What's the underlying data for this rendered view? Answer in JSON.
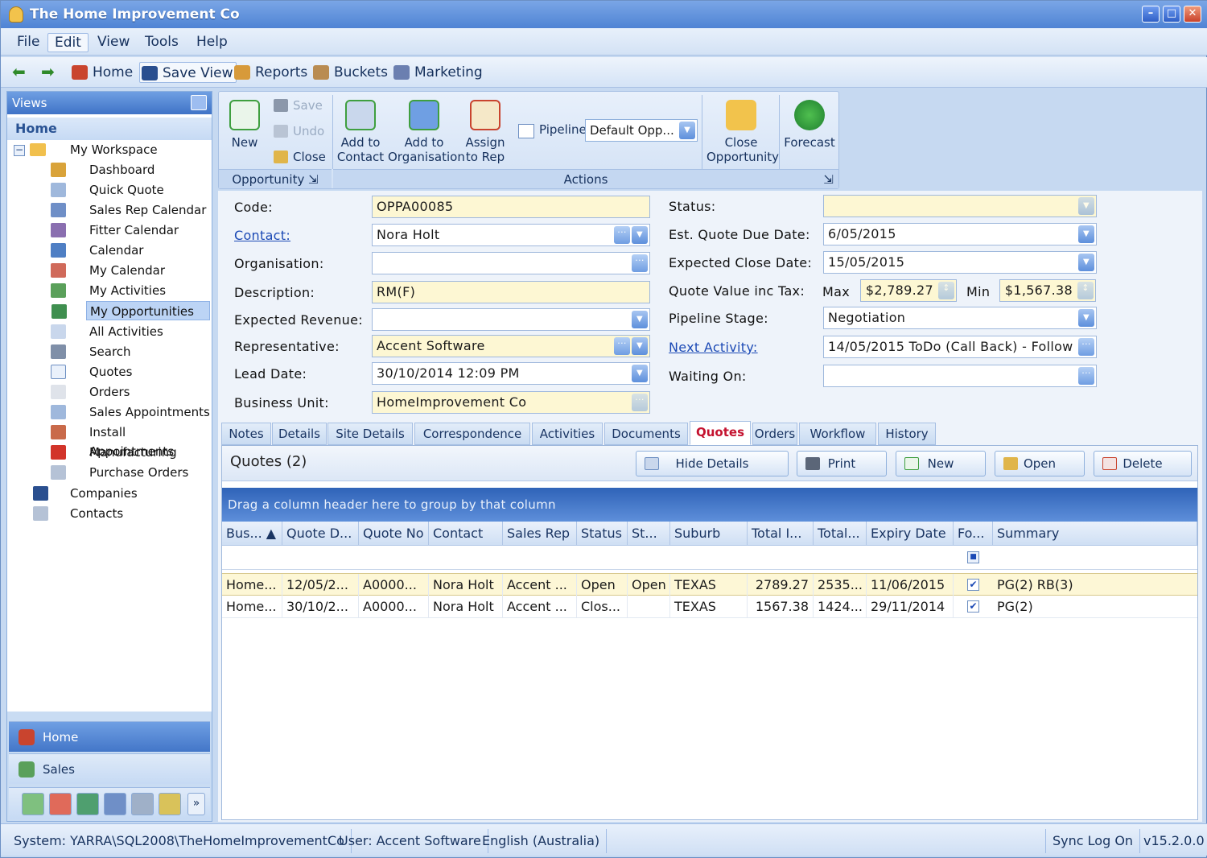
{
  "window": {
    "title": "The Home Improvement Co"
  },
  "menu": [
    "File",
    "Edit",
    "View",
    "Tools",
    "Help"
  ],
  "nav": {
    "home": "Home",
    "save_view": "Save View",
    "reports": "Reports",
    "buckets": "Buckets",
    "marketing": "Marketing"
  },
  "sidebar": {
    "header": "Views",
    "section": "Home",
    "workspace": "My Workspace",
    "items": [
      "Dashboard",
      "Quick Quote",
      "Sales Rep Calendar",
      "Fitter Calendar",
      "Calendar",
      "My Calendar",
      "My Activities",
      "My Opportunities",
      "All Activities",
      "Search",
      "Quotes",
      "Orders",
      "Sales Appointments",
      "Install Appointments",
      "Manufacturing",
      "Purchase Orders"
    ],
    "companies": "Companies",
    "contacts": "Contacts",
    "bottom_home": "Home",
    "bottom_sales": "Sales"
  },
  "ribbon": {
    "new": "New",
    "save": "Save",
    "undo": "Undo",
    "close": "Close",
    "add_to_contact_1": "Add to",
    "add_to_contact_2": "Contact",
    "add_to_org_1": "Add to",
    "add_to_org_2": "Organisation",
    "assign_1": "Assign",
    "assign_2": "to Rep",
    "pipeline_label": "Pipeline",
    "pipeline_value": "Default Opp...",
    "close_opp_1": "Close",
    "close_opp_2": "Opportunity",
    "forecast": "Forecast",
    "group_opportunity": "Opportunity",
    "group_actions": "Actions"
  },
  "form": {
    "code_label": "Code:",
    "code": "OPPA00085",
    "contact_label": "Contact:",
    "contact": "Nora Holt",
    "org_label": "Organisation:",
    "org": "",
    "desc_label": "Description:",
    "desc": "RM(F)",
    "exp_rev_label": "Expected Revenue:",
    "exp_rev": "",
    "rep_label": "Representative:",
    "rep": "Accent Software",
    "lead_label": "Lead Date:",
    "lead": "30/10/2014 12:09 PM",
    "bu_label": "Business Unit:",
    "bu": "HomeImprovement Co",
    "status_label": "Status:",
    "status": "",
    "quote_due_label": "Est. Quote Due Date:",
    "quote_due": "6/05/2015",
    "close_date_label": "Expected Close Date:",
    "close_date": "15/05/2015",
    "qv_label": "Quote Value inc Tax:",
    "max_label": "Max",
    "max": "$2,789.27",
    "min_label": "Min",
    "min": "$1,567.38",
    "stage_label": "Pipeline Stage:",
    "stage": "Negotiation",
    "next_label": "Next Activity:",
    "next": "14/05/2015 ToDo (Call Back) - Follow",
    "waiting_label": "Waiting On:",
    "waiting": ""
  },
  "tabs": [
    "Notes",
    "Details",
    "Site Details",
    "Correspondence",
    "Activities",
    "Documents",
    "Quotes",
    "Orders",
    "Workflow",
    "History"
  ],
  "quotes": {
    "title": "Quotes (2)",
    "buttons": {
      "hide": "Hide Details",
      "print": "Print",
      "new": "New",
      "open": "Open",
      "delete": "Delete"
    },
    "group_hint": "Drag a column header here to group by that column",
    "columns": [
      "Bus... ▲",
      "Quote D...",
      "Quote No",
      "Contact",
      "Sales Rep",
      "Status",
      "St...",
      "Suburb",
      "Total I...",
      "Total...",
      "Expiry Date",
      "Fo...",
      "Summary"
    ],
    "rows": [
      [
        "Home...",
        "12/05/2...",
        "A0000...",
        "Nora Holt",
        "Accent ...",
        "Open",
        "Open",
        "TEXAS",
        "2789.27",
        "2535...",
        "11/06/2015",
        "✔",
        "PG(2) RB(3)"
      ],
      [
        "Home...",
        "30/10/2...",
        "A0000...",
        "Nora Holt",
        "Accent ...",
        "Clos...",
        "",
        "TEXAS",
        "1567.38",
        "1424...",
        "29/11/2014",
        "✔",
        "PG(2)"
      ]
    ]
  },
  "status": {
    "system": "System: YARRA\\SQL2008\\TheHomeImprovementCo",
    "user": "User: Accent Software",
    "lang": "English (Australia)",
    "sync": "Sync Log On",
    "version": "v15.2.0.0"
  }
}
